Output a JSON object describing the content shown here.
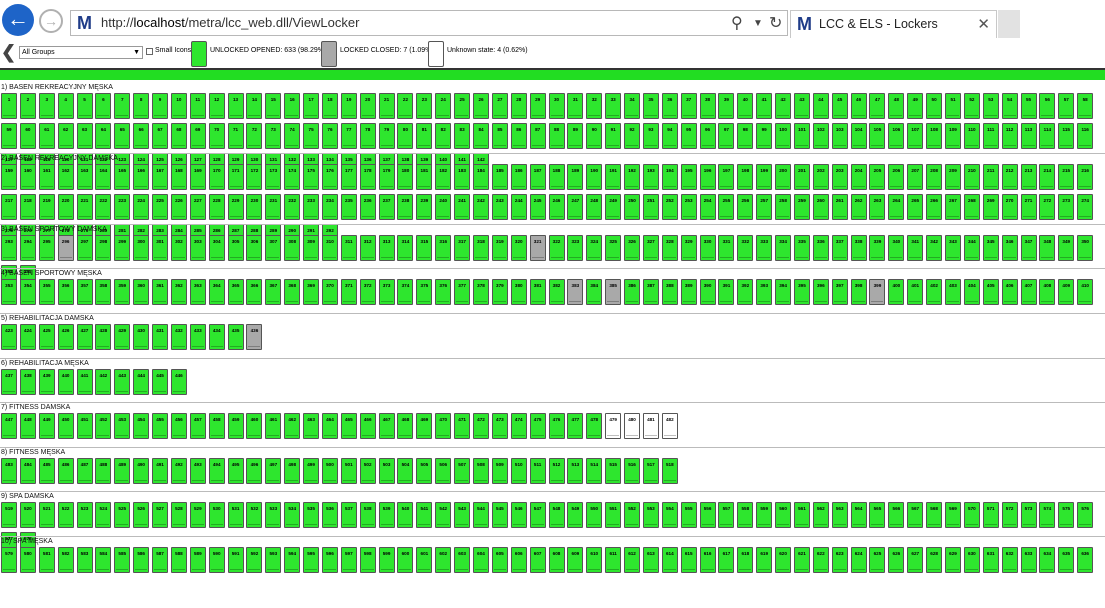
{
  "browser": {
    "url_prefix": "http://",
    "url_host": "localhost",
    "url_path": "/metra/lcc_web.dll/ViewLocker",
    "tab_title": "LCC & ELS - Lockers"
  },
  "toolbar": {
    "group_select": "All Groups",
    "small_icons_label": "Small Icons",
    "legend_open": "UNLOCKED OPENED: 633 (98.29%)",
    "legend_closed": "LOCKED CLOSED: 7 (1.09%)",
    "legend_unknown": "Unknown state: 4 (0.62%)"
  },
  "colors": {
    "open": "#2ee62e",
    "closed": "#a9a9a9",
    "unknown": "#ffffff"
  },
  "sections": [
    {
      "title": "1) BASEN REKREACYJNY MĘSKA",
      "start": 1,
      "end": 142,
      "closed": [],
      "unknown": []
    },
    {
      "title": "2) BASEN REKREACYJNY DAMSKA",
      "start": 159,
      "end": 292,
      "closed": [],
      "unknown": []
    },
    {
      "title": "3) BASEN SPORTOWY DAMSKA",
      "start": 293,
      "end": 352,
      "closed": [
        296,
        321
      ],
      "unknown": []
    },
    {
      "title": "4) BASEN SPORTOWY MĘSKA",
      "start": 353,
      "end": 410,
      "closed": [
        383,
        385,
        399
      ],
      "unknown": []
    },
    {
      "title": "5) REHABILITACJA DAMSKA",
      "start": 423,
      "end": 436,
      "closed": [
        436
      ],
      "unknown": []
    },
    {
      "title": "6) REHABILITACJA MĘSKA",
      "start": 437,
      "end": 446,
      "closed": [],
      "unknown": []
    },
    {
      "title": "7) FITNESS DAMSKA",
      "start": 447,
      "end": 482,
      "closed": [],
      "unknown": [
        479,
        480,
        481,
        482
      ]
    },
    {
      "title": "8) FITNESS MĘSKA",
      "start": 483,
      "end": 518,
      "closed": [],
      "unknown": []
    },
    {
      "title": "9) SPA DAMSKA",
      "start": 519,
      "end": 578,
      "closed": [],
      "unknown": []
    },
    {
      "title": "10) SPA MĘSKA",
      "start": 579,
      "end": 636,
      "closed": [],
      "unknown": []
    }
  ]
}
